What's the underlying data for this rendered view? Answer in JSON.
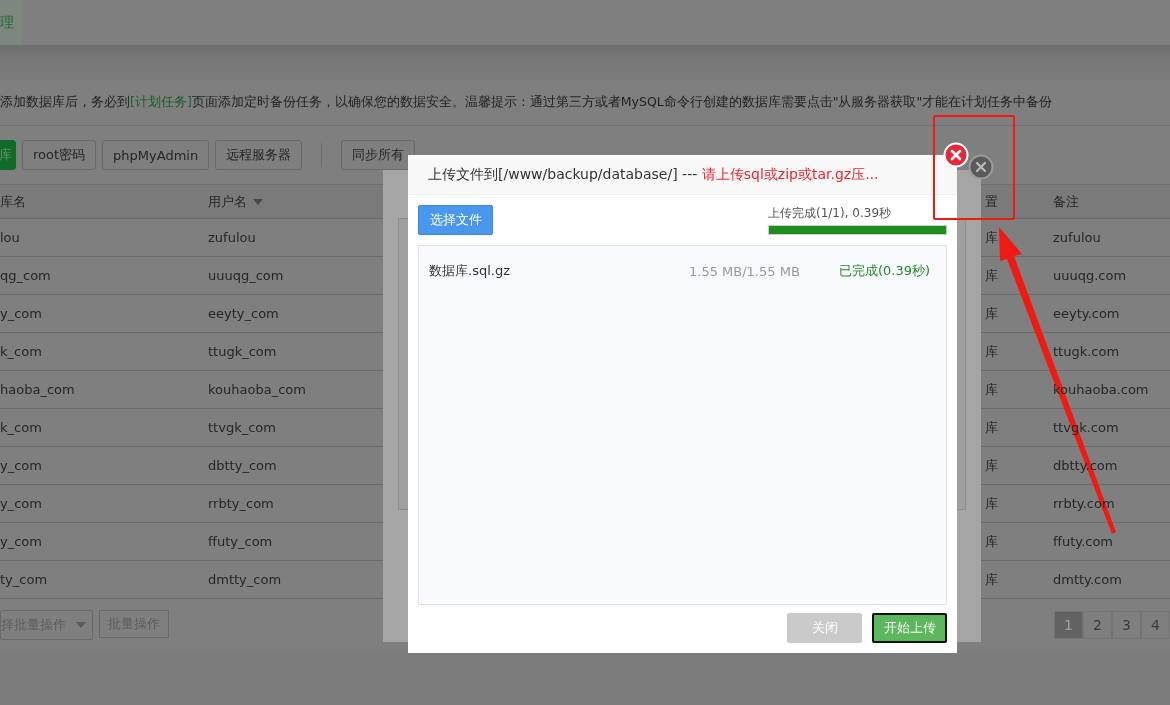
{
  "top_tab": {
    "label": "理",
    "selected": true
  },
  "notice": {
    "before": "添加数据库后，务必到",
    "link": "[计划任务]",
    "after": "页面添加定时备份任务，以确保您的数据安全。温馨提示：通过第三方或者MySQL命令行创建的数据库需要点击\"从服务器获取\"才能在计划任务中备份"
  },
  "toolbar": [
    {
      "label": "库",
      "kind": "primary"
    },
    {
      "label": "root密码",
      "kind": "default"
    },
    {
      "label": "phpMyAdmin",
      "kind": "default"
    },
    {
      "label": "远程服务器",
      "kind": "default"
    },
    {
      "kind": "divider"
    },
    {
      "label": "同步所有",
      "kind": "default"
    }
  ],
  "table": {
    "columns": [
      {
        "label": "库名",
        "sortable": false
      },
      {
        "label": "用户名",
        "sortable": true
      },
      {
        "label": "置",
        "sortable": false
      },
      {
        "label": "备注",
        "sortable": false
      }
    ],
    "rows": [
      [
        "lou",
        "zufulou",
        "库",
        "zufulou"
      ],
      [
        "qg_com",
        "uuuqg_com",
        "库",
        "uuuqg.com"
      ],
      [
        "y_com",
        "eeyty_com",
        "库",
        "eeyty.com"
      ],
      [
        "k_com",
        "ttugk_com",
        "库",
        "ttugk.com"
      ],
      [
        "haoba_com",
        "kouhaoba_com",
        "库",
        "kouhaoba.com"
      ],
      [
        "k_com",
        "ttvgk_com",
        "库",
        "ttvgk.com"
      ],
      [
        "y_com",
        "dbtty_com",
        "库",
        "dbtty.com"
      ],
      [
        "y_com",
        "rrbty_com",
        "库",
        "rrbty.com"
      ],
      [
        "y_com",
        "ffuty_com",
        "库",
        "ffuty.com"
      ],
      [
        "ty_com",
        "dmtty_com",
        "库",
        "dmtty.com"
      ]
    ]
  },
  "batch": {
    "select": "择批量操作",
    "button": "批量操作"
  },
  "pagination": [
    {
      "label": "1",
      "selected": true
    },
    {
      "label": "2",
      "selected": false
    },
    {
      "label": "3",
      "selected": false
    },
    {
      "label": "4",
      "selected": false
    }
  ],
  "upload_dialog": {
    "title": "上传文件到[/www/backup/database/] --- ",
    "warning": "请上传sql或zip或tar.gz压...",
    "choose_button": "选择文件",
    "progress": {
      "label": "上传完成(1/1), 0.39秒",
      "level": 1
    },
    "files": [
      {
        "name": "数据库.sql.gz",
        "size": "1.55 MB/1.55 MB",
        "status": "已完成(0.39秒)",
        "done": true
      }
    ],
    "buttons": [
      {
        "label": "关闭",
        "kind": "close",
        "disabled": true
      },
      {
        "label": "开始上传",
        "kind": "primary",
        "focused": true
      }
    ]
  }
}
